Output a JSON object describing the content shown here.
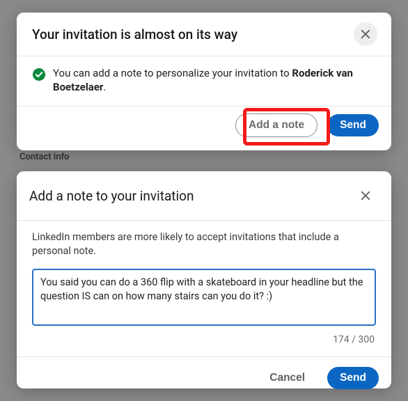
{
  "background": {
    "contact_info": "Contact info"
  },
  "dialog1": {
    "title": "Your invitation is almost on its way",
    "info_prefix": "You can add a note to personalize your invitation to ",
    "recipient_name": "Roderick van Boetzelaer",
    "info_suffix": ".",
    "add_note_label": "Add a note",
    "send_label": "Send"
  },
  "dialog2": {
    "title": "Add a note to your invitation",
    "helper": "LinkedIn members are more likely to accept invitations that include a personal note.",
    "note_value": "You said you can do a 360 flip with a skateboard in your headline but the question IS can on how many stairs can you do it? :)",
    "counter": "174 / 300",
    "cancel_label": "Cancel",
    "send_label": "Send"
  }
}
